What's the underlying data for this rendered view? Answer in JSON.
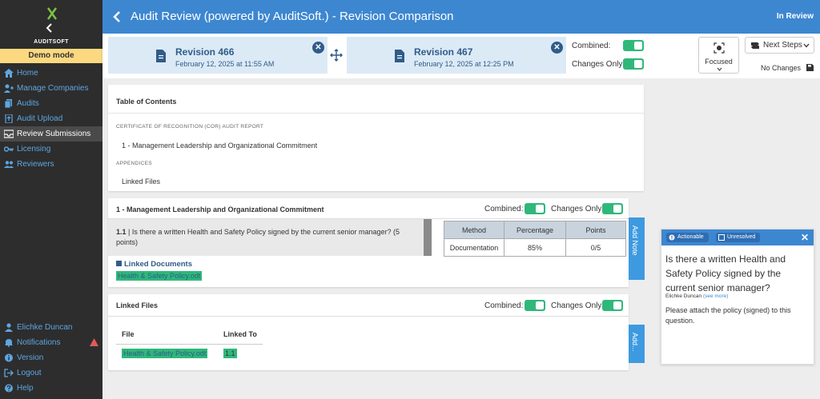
{
  "sidebar": {
    "logo": "AuditXchange",
    "brand": "AUDITSOFT",
    "demo": "Demo mode",
    "nav": [
      {
        "label": "Home"
      },
      {
        "label": "Manage Companies"
      },
      {
        "label": "Audits"
      },
      {
        "label": "Audit Upload"
      },
      {
        "label": "Review Submissions"
      },
      {
        "label": "Licensing"
      },
      {
        "label": "Reviewers"
      }
    ],
    "bottom": [
      {
        "label": "Elichke Duncan"
      },
      {
        "label": "Notifications"
      },
      {
        "label": "Version"
      },
      {
        "label": "Logout"
      },
      {
        "label": "Help"
      }
    ]
  },
  "header": {
    "title": "Audit Review (powered by AuditSoft.) - Revision Comparison",
    "status": "In Review"
  },
  "revisions": [
    {
      "name": "Revision 466",
      "date": "February 12, 2025 at 11:55 AM"
    },
    {
      "name": "Revision 467",
      "date": "February 12, 2025 at 12:25 PM"
    }
  ],
  "controls": {
    "combined": "Combined:",
    "changes_only": "Changes Only:",
    "focused": "Focused",
    "next_steps": "Next Steps",
    "no_changes": "No Changes"
  },
  "toc": {
    "title": "Table of Contents",
    "sections": [
      {
        "heading": "CERTIFICATE OF RECOGNITION (COR) AUDIT REPORT",
        "item": "1 - Management Leadership and Organizational Commitment"
      },
      {
        "heading": "APPENDICES",
        "item": "Linked Files"
      }
    ]
  },
  "section1": {
    "title": "1 - Management Leadership and Organizational Commitment",
    "combined": "Combined:",
    "changes_only": "Changes Only:",
    "question_num": "1.1",
    "question": "Is there a written Health and Safety Policy signed by the current senior manager? (5 points)",
    "table": {
      "headers": [
        "Method",
        "Percentage",
        "Points"
      ],
      "row": [
        "Documentation",
        "85%",
        "0/5"
      ]
    },
    "linked_docs_label": "Linked Documents",
    "linked_doc": "Health & Safety Policy.odt",
    "add_note": "Add Note"
  },
  "linked_files": {
    "title": "Linked Files",
    "combined": "Combined:",
    "changes_only": "Changes Only:",
    "col_file": "File",
    "col_linked": "Linked To",
    "file": "Health & Safety Policy.odt",
    "linked_to": "1.1",
    "add_note": "Add..."
  },
  "comment": {
    "chip_actionable": "Actionable",
    "chip_unresolved": "Unresolved",
    "question": "Is there a written Health and Safety Policy signed by the current senior manager?",
    "author": "Elichke Duncan",
    "see_more": "(see more)",
    "body": "Please attach the policy (signed) to this question."
  }
}
